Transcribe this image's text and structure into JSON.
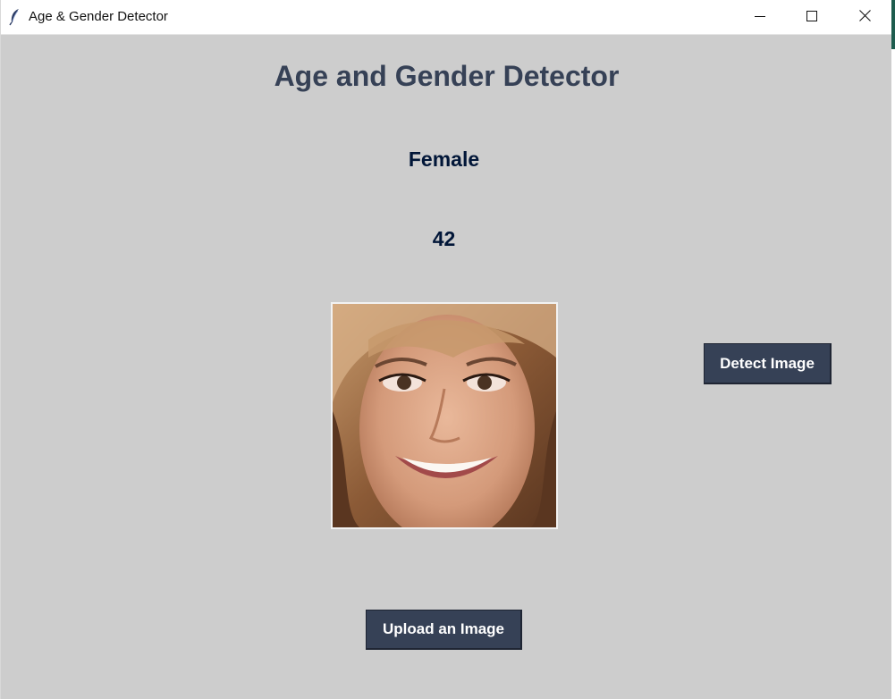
{
  "window": {
    "title": "Age & Gender Detector",
    "icon": "feather-icon",
    "controls": [
      "minimize-icon",
      "maximize-icon",
      "close-icon"
    ]
  },
  "app": {
    "heading": "Age and Gender Detector",
    "gender_result": "Female",
    "age_result": "42",
    "detect_button": "Detect Image",
    "upload_button": "Upload an Image"
  },
  "colors": {
    "background": "#cdcdcd",
    "heading": "#364156",
    "result_text": "#011638",
    "button_bg": "#364156",
    "button_text": "#ffffff"
  }
}
